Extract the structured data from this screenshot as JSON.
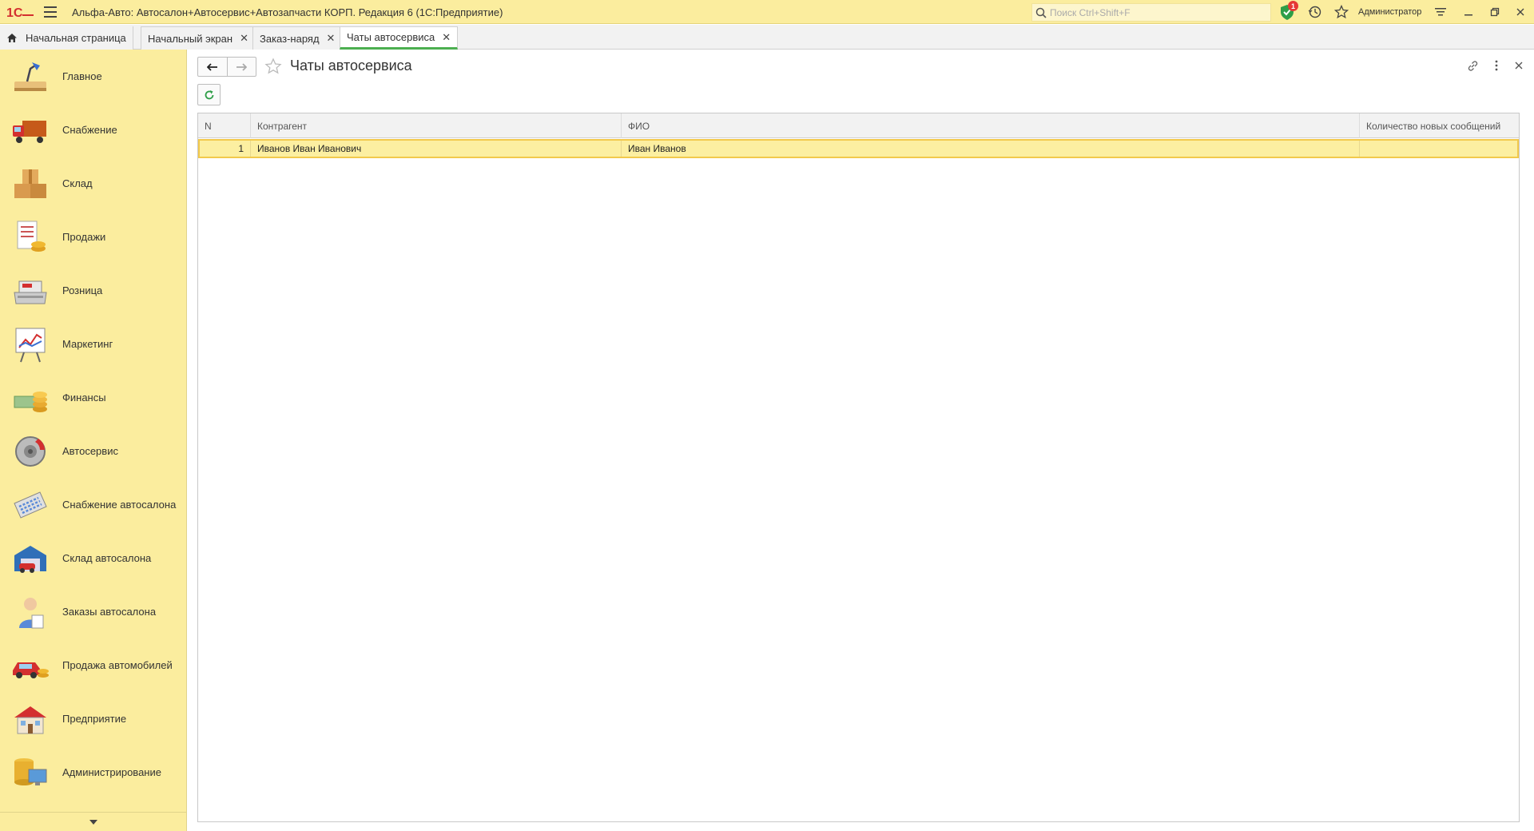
{
  "titlebar": {
    "title": "Альфа-Авто: Автосалон+Автосервис+Автозапчасти КОРП. Редакция 6  (1С:Предприятие)",
    "search_placeholder": "Поиск Ctrl+Shift+F",
    "notification_count": "1",
    "user": "Администратор"
  },
  "tabs": [
    {
      "label": "Начальная страница"
    },
    {
      "label": "Начальный экран"
    },
    {
      "label": "Заказ-наряд"
    },
    {
      "label": "Чаты автосервиса"
    }
  ],
  "sidebar": {
    "items": [
      {
        "label": "Главное",
        "icon": "desk-lamp-icon"
      },
      {
        "label": "Снабжение",
        "icon": "truck-icon"
      },
      {
        "label": "Склад",
        "icon": "boxes-icon"
      },
      {
        "label": "Продажи",
        "icon": "invoice-coins-icon"
      },
      {
        "label": "Розница",
        "icon": "cash-register-icon"
      },
      {
        "label": "Маркетинг",
        "icon": "chart-board-icon"
      },
      {
        "label": "Финансы",
        "icon": "money-coins-icon"
      },
      {
        "label": "Автосервис",
        "icon": "brake-disc-icon"
      },
      {
        "label": "Снабжение автосалона",
        "icon": "calculator-icon"
      },
      {
        "label": "Склад автосалона",
        "icon": "garage-icon"
      },
      {
        "label": "Заказы автосалона",
        "icon": "manager-icon"
      },
      {
        "label": "Продажа автомобилей",
        "icon": "car-coins-icon"
      },
      {
        "label": "Предприятие",
        "icon": "building-icon"
      },
      {
        "label": "Администрирование",
        "icon": "database-monitor-icon"
      }
    ]
  },
  "page": {
    "title": "Чаты автосервиса"
  },
  "table": {
    "columns": [
      "N",
      "Контрагент",
      "ФИО",
      "Количество новых сообщений"
    ],
    "rows": [
      {
        "n": "1",
        "counterparty": "Иванов Иван Иванович",
        "fio": "Иван Иванов",
        "new_messages": ""
      }
    ]
  },
  "colors": {
    "panel": "#fbed9e",
    "accent_green": "#4caf50",
    "selected_row": "#fcefa1"
  }
}
